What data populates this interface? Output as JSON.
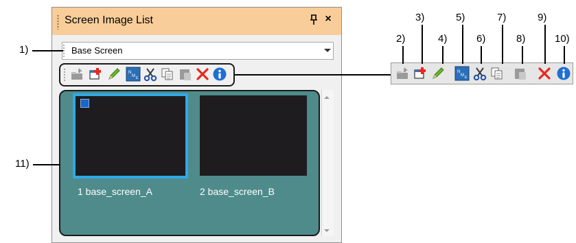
{
  "panel": {
    "title": "Screen Image List",
    "pin_glyph": "⑂",
    "close_glyph": "×"
  },
  "dropdown": {
    "value": "Base Screen"
  },
  "toolbar": {
    "buttons": [
      {
        "name": "screen-from-template-icon"
      },
      {
        "name": "new-screen-icon"
      },
      {
        "name": "edit-pencil-icon"
      },
      {
        "name": "name-display-icon"
      },
      {
        "name": "cut-icon"
      },
      {
        "name": "copy-icon"
      },
      {
        "name": "paste-icon"
      },
      {
        "name": "delete-icon"
      },
      {
        "name": "properties-info-icon"
      }
    ]
  },
  "screens": [
    {
      "label": "1 base_screen_A"
    },
    {
      "label": "2 base_screen_B"
    }
  ],
  "callouts": {
    "c1": "1)",
    "c2": "2)",
    "c3": "3)",
    "c4": "4)",
    "c5": "5)",
    "c6": "6)",
    "c7": "7)",
    "c8": "8)",
    "c9": "9)",
    "c10": "10)",
    "c11": "11)"
  },
  "colors": {
    "titlebar": "#f8cd9a",
    "image_area": "#4f8b8b",
    "selected_border": "#2fa9e8",
    "delete_red": "#e8281e",
    "info_blue": "#1f6fd1"
  }
}
